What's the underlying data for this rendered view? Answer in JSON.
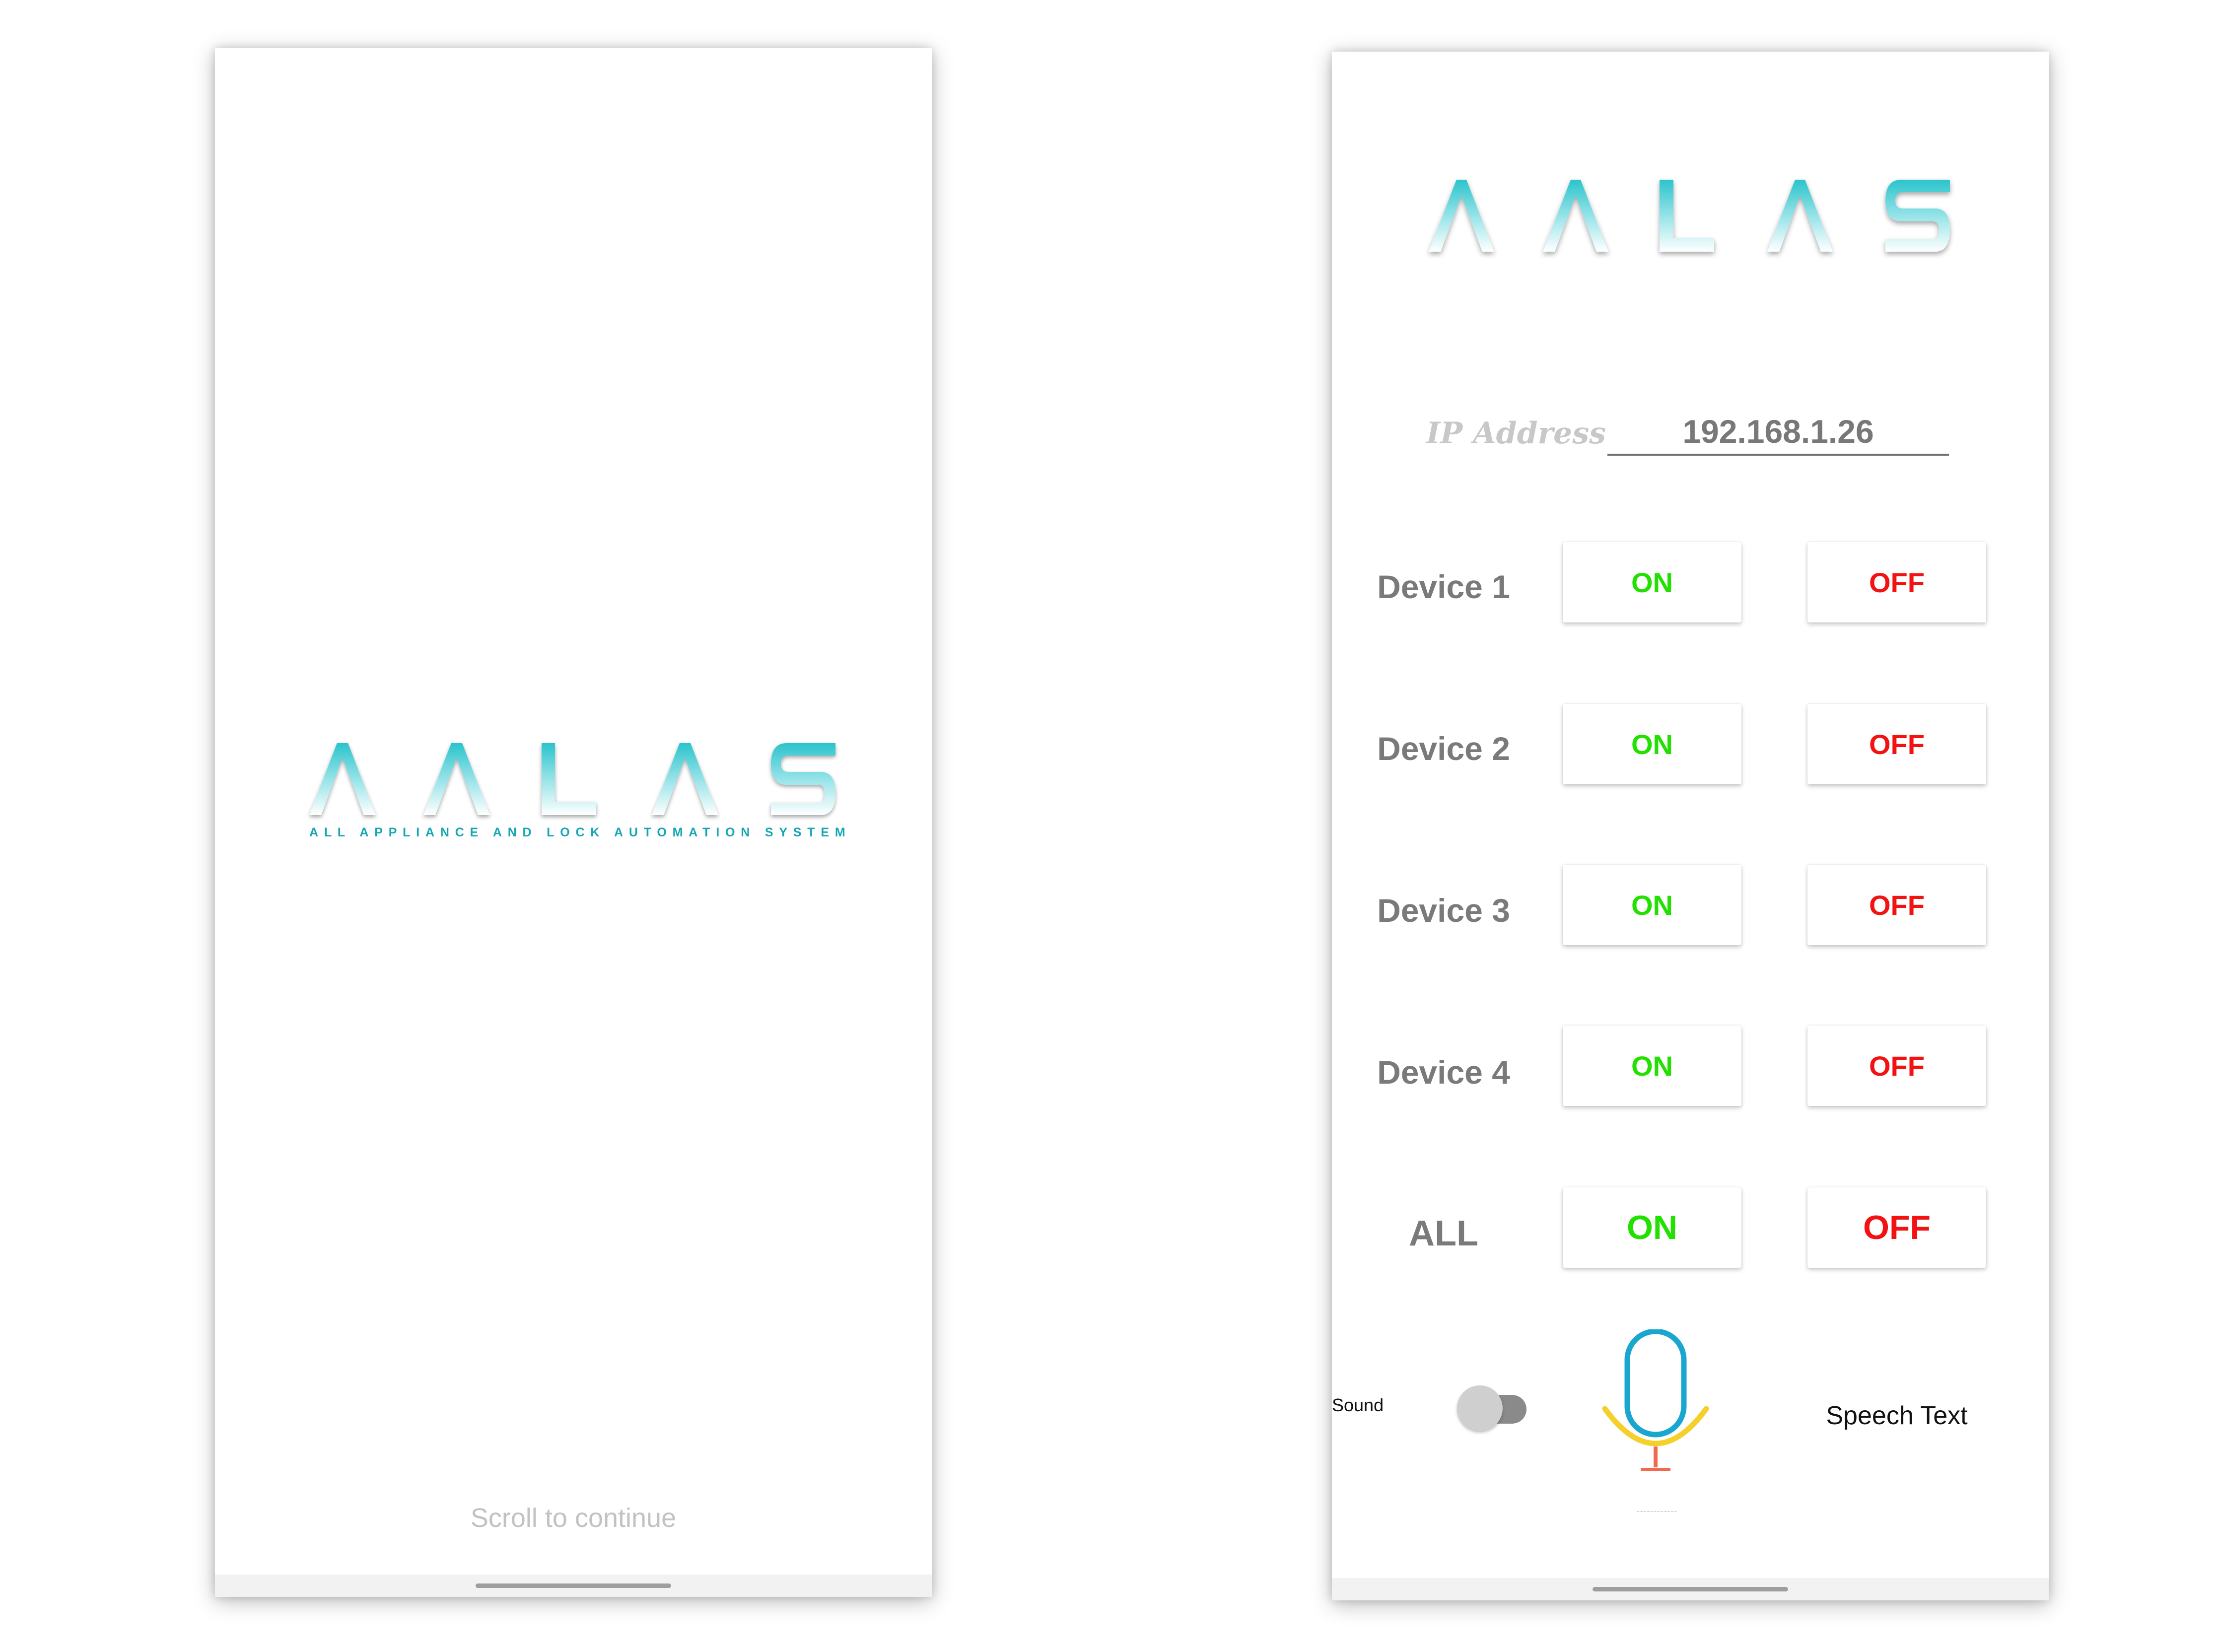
{
  "splash": {
    "logo_letters": [
      "Λ",
      "Λ",
      "L",
      "Λ",
      "S"
    ],
    "logo_word": "AALAS",
    "tagline": "ALL APPLIANCE AND LOCK AUTOMATION SYSTEM",
    "scroll_hint": "Scroll to continue"
  },
  "control": {
    "logo_letters": [
      "Λ",
      "Λ",
      "L",
      "Λ",
      "S"
    ],
    "logo_word": "AALAS",
    "ip_label": "IP Address",
    "ip_value": "192.168.1.26",
    "devices": [
      {
        "label": "Device 1",
        "on": "ON",
        "off": "OFF"
      },
      {
        "label": "Device 2",
        "on": "ON",
        "off": "OFF"
      },
      {
        "label": "Device 3",
        "on": "ON",
        "off": "OFF"
      },
      {
        "label": "Device 4",
        "on": "ON",
        "off": "OFF"
      }
    ],
    "all": {
      "label": "ALL",
      "on": "ON",
      "off": "OFF"
    },
    "sound_label": "Sound",
    "sound_enabled": false,
    "speech_text": "Speech Text",
    "mic_caption": "~~~~~~~~~~~~"
  },
  "colors": {
    "logo_teal": "#2bc4cc",
    "tagline_teal": "#14a6b4",
    "on_green": "#22e000",
    "off_red": "#f31212",
    "label_gray": "#7a7a7a",
    "mic_blue": "#1aa7cf",
    "mic_yellow": "#f5cf2a",
    "mic_stand_red": "#f06a52"
  },
  "icons": {
    "microphone": "microphone-icon",
    "toggle": "sound-toggle"
  }
}
